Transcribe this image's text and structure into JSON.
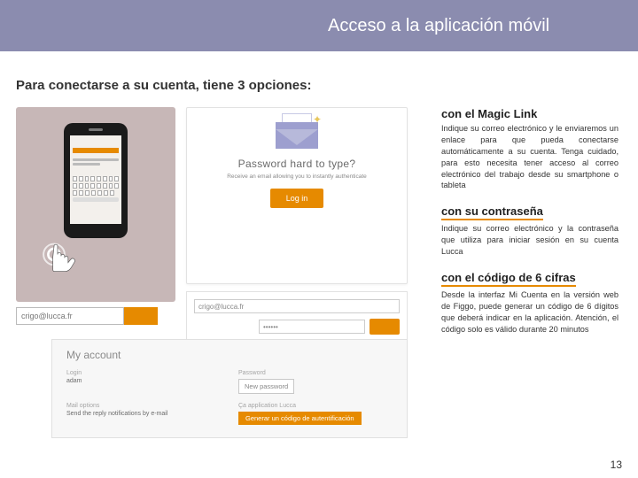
{
  "header": {
    "title": "Acceso a la aplicación móvil"
  },
  "subhead": "Para conectarse a su cuenta, tiene 3 opciones:",
  "options": {
    "magic": {
      "title": "con el Magic Link",
      "body": "Indique su correo electrónico y le enviaremos un enlace para que pueda conectarse automáticamente a su cuenta. Tenga cuidado, para esto necesita tener acceso al correo electrónico del trabajo desde su smartphone o tableta"
    },
    "pwd": {
      "title": "con su contraseña",
      "body": "Indique su correo electrónico y la contraseña que utiliza para iniciar sesión en su cuenta Lucca"
    },
    "code": {
      "title": "con el código de 6 cifras",
      "body": "Desde la interfaz Mi Cuenta en la versión web de Figgo, puede generar un código de 6 dígitos que deberá indicar en la aplicación. Atención, el código solo es válido durante 20 minutos"
    }
  },
  "illus": {
    "email_sample": "crigo@lucca.fr",
    "envelope_title": "Password hard to type?",
    "envelope_sub": "Receive an email allowing you to instantly authenticate",
    "login_label": "Log in",
    "pwd_dots": "••••••",
    "account": {
      "title": "My account",
      "labels": {
        "login": "Login",
        "pwd": "Password",
        "mail": "Mail options",
        "app": "Ça application Lucca"
      },
      "values": {
        "login": "adam",
        "mail": "Send the reply notifications by e-mail"
      },
      "newpwd": "New password",
      "gencode": "Generar un código de autentificación"
    }
  },
  "page_number": "13"
}
